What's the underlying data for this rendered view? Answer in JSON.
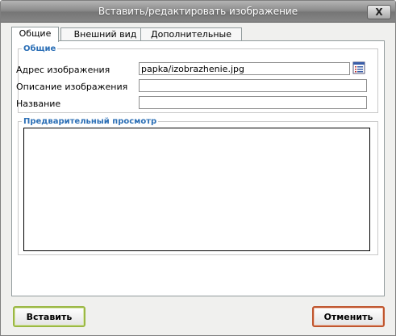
{
  "window": {
    "title": "Вставить/редактировать изображение",
    "close_label": "X"
  },
  "tabs": [
    {
      "label": "Общие",
      "active": true
    },
    {
      "label": "Внешний вид",
      "active": false
    },
    {
      "label": "Дополнительные",
      "active": false
    }
  ],
  "general": {
    "legend": "Общие",
    "image_url": {
      "label": "Адрес изображения",
      "value": "papka/izobrazhenie.jpg"
    },
    "description": {
      "label": "Описание изображения",
      "value": ""
    },
    "title": {
      "label": "Название",
      "value": ""
    },
    "browse_icon": "file-browser-icon"
  },
  "preview": {
    "legend": "Предварительный просмотр"
  },
  "buttons": {
    "insert": "Вставить",
    "cancel": "Отменить"
  },
  "colors": {
    "legend": "#2b6fb6",
    "insert_border": "#9bb844",
    "cancel_border": "#c0562e"
  }
}
